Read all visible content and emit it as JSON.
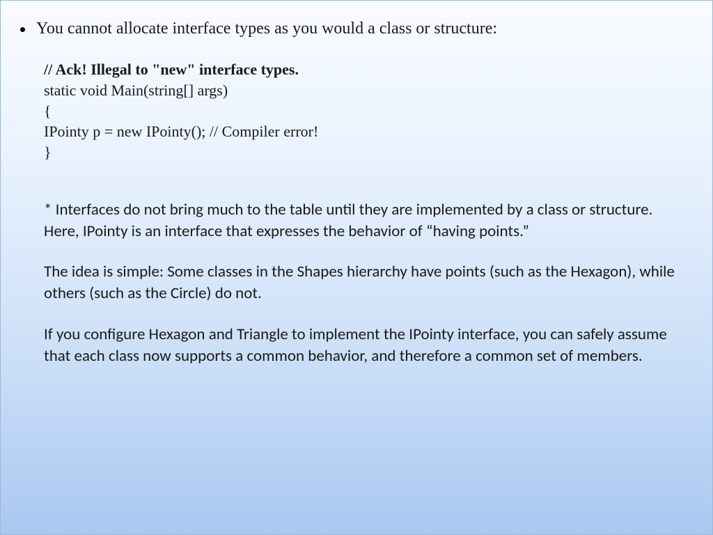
{
  "bullet": "You cannot allocate interface types as you would a class or structure:",
  "code": {
    "comment": "// Ack! Illegal to \"new\" interface types.",
    "line1": "static void Main(string[] args)",
    "line2": "{",
    "line3": "IPointy p = new IPointy(); // Compiler error!",
    "line4": "}"
  },
  "body": {
    "p1": "* Interfaces do not bring much to the table until they are implemented by a class or structure. Here, IPointy is an interface that expresses the behavior of “having points.”",
    "p2": "The idea is simple: Some classes in the Shapes hierarchy have points (such as the Hexagon), while others (such as the Circle) do not.",
    "p3": "If you configure Hexagon and Triangle to implement the IPointy interface, you can safely assume that each class now supports a common behavior, and therefore a common set of members."
  }
}
